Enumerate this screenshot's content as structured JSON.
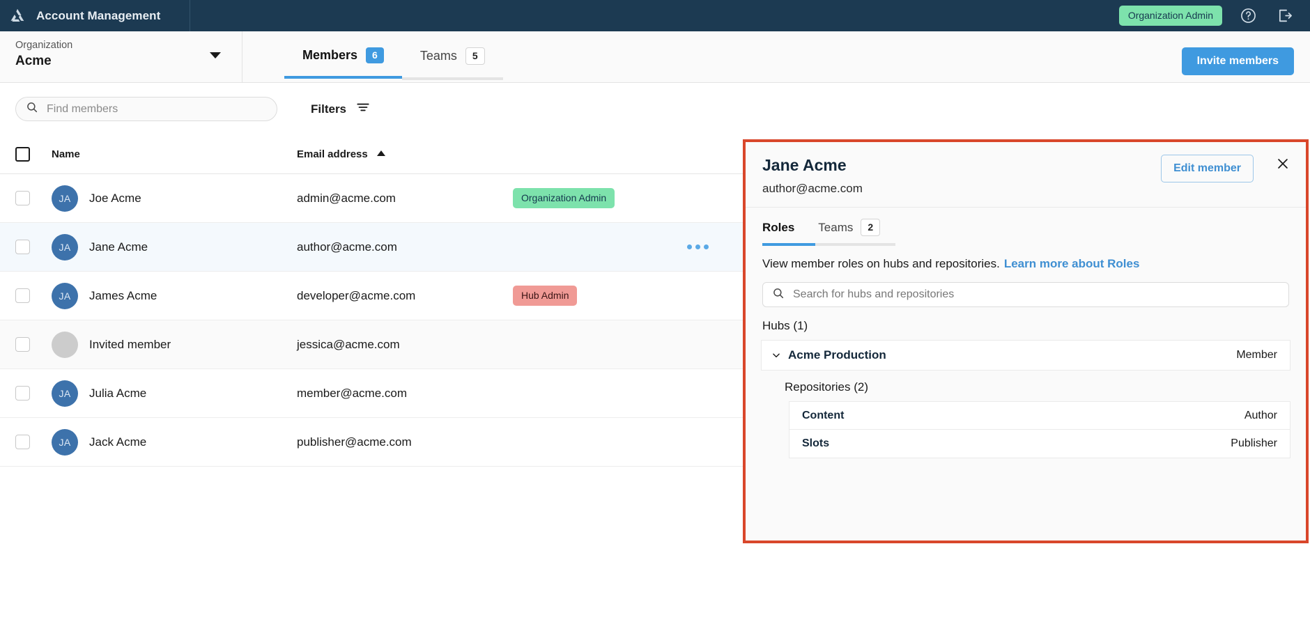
{
  "topbar": {
    "logo_icon": "triangle-recycle-logo",
    "title": "Account Management",
    "role_badge": "Organization Admin",
    "help_icon": "question-circle-icon",
    "logout_icon": "logout-icon",
    "bg_color": "#1c3a52",
    "badge_color": "#7de2ac"
  },
  "org_selector": {
    "label": "Organization",
    "value": "Acme",
    "caret_icon": "chevron-down-icon"
  },
  "tabs": [
    {
      "label": "Members",
      "count": "6",
      "active": true
    },
    {
      "label": "Teams",
      "count": "5",
      "active": false
    }
  ],
  "actions": {
    "invite_members": "Invite members"
  },
  "toolbar": {
    "search_placeholder": "Find members",
    "search_value": "",
    "search_icon": "search-icon",
    "filters_label": "Filters",
    "filters_icon": "filter-icon"
  },
  "table": {
    "columns": [
      {
        "label": "Name"
      },
      {
        "label": "Email address",
        "sorted": "asc",
        "sort_icon": "caret-up-icon"
      }
    ],
    "rows": [
      {
        "initials": "JA",
        "name": "Joe Acme",
        "email": "admin@acme.com",
        "tag": "Organization Admin",
        "tag_color": "green",
        "selected": false,
        "invited": false,
        "menu": false
      },
      {
        "initials": "JA",
        "name": "Jane Acme",
        "email": "author@acme.com",
        "tag": "",
        "tag_color": "",
        "selected": true,
        "invited": false,
        "menu": true
      },
      {
        "initials": "JA",
        "name": "James Acme",
        "email": "developer@acme.com",
        "tag": "Hub Admin",
        "tag_color": "red",
        "selected": false,
        "invited": false,
        "menu": false
      },
      {
        "initials": "",
        "name": "Invited member",
        "email": "jessica@acme.com",
        "tag": "",
        "tag_color": "",
        "selected": false,
        "invited": true,
        "menu": false
      },
      {
        "initials": "JA",
        "name": "Julia Acme",
        "email": "member@acme.com",
        "tag": "",
        "tag_color": "",
        "selected": false,
        "invited": false,
        "menu": false
      },
      {
        "initials": "JA",
        "name": "Jack Acme",
        "email": "publisher@acme.com",
        "tag": "",
        "tag_color": "",
        "selected": false,
        "invited": false,
        "menu": false
      }
    ]
  },
  "panel": {
    "highlight_color": "#d9472b",
    "title": "Jane Acme",
    "email": "author@acme.com",
    "edit_button": "Edit member",
    "close_icon": "close-icon",
    "tabs": [
      {
        "label": "Roles",
        "count": "",
        "active": true
      },
      {
        "label": "Teams",
        "count": "2",
        "active": false
      }
    ],
    "description": "View member roles on hubs and repositories.",
    "learn_more": "Learn more about Roles",
    "search_placeholder": "Search for hubs and repositories",
    "search_value": "",
    "search_icon": "search-icon",
    "hubs_label": "Hubs (1)",
    "hub": {
      "name": "Acme Production",
      "role": "Member",
      "chevron_icon": "chevron-down-icon",
      "repos_label": "Repositories (2)",
      "repositories": [
        {
          "name": "Content",
          "role": "Author"
        },
        {
          "name": "Slots",
          "role": "Publisher"
        }
      ]
    }
  }
}
